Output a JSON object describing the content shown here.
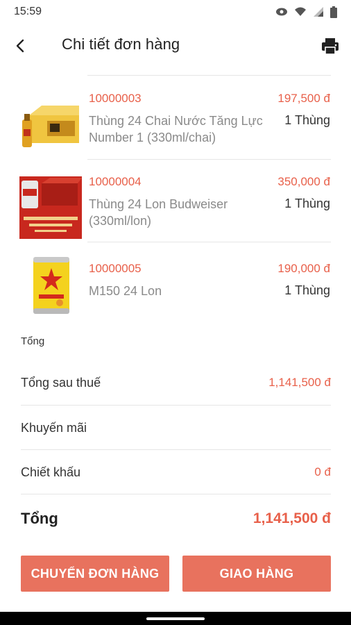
{
  "status_bar": {
    "time": "15:59"
  },
  "header": {
    "title": "Chi tiết đơn hàng"
  },
  "items": [
    {
      "code": "10000003",
      "price": "197,500 đ",
      "name": "Thùng 24 Chai Nước Tăng Lực Number 1 (330ml/chai)",
      "qty": "1 Thùng"
    },
    {
      "code": "10000004",
      "price": "350,000 đ",
      "name": "Thùng 24 Lon Budweiser (330ml/lon)",
      "qty": "1 Thùng"
    },
    {
      "code": "10000005",
      "price": "190,000 đ",
      "name": "M150 24 Lon",
      "qty": "1 Thùng"
    }
  ],
  "summary": {
    "section_title": "Tổng",
    "after_tax_label": "Tổng sau thuế",
    "after_tax_value": "1,141,500 đ",
    "promo_label": "Khuyến mãi",
    "discount_label": "Chiết khấu",
    "discount_value": "0 đ",
    "total_label": "Tổng",
    "total_value": "1,141,500 đ"
  },
  "buttons": {
    "transfer": "CHUYỂN ĐƠN HÀNG",
    "deliver": "GIAO HÀNG"
  },
  "colors": {
    "accent": "#e8604a",
    "button": "#e8725e"
  }
}
